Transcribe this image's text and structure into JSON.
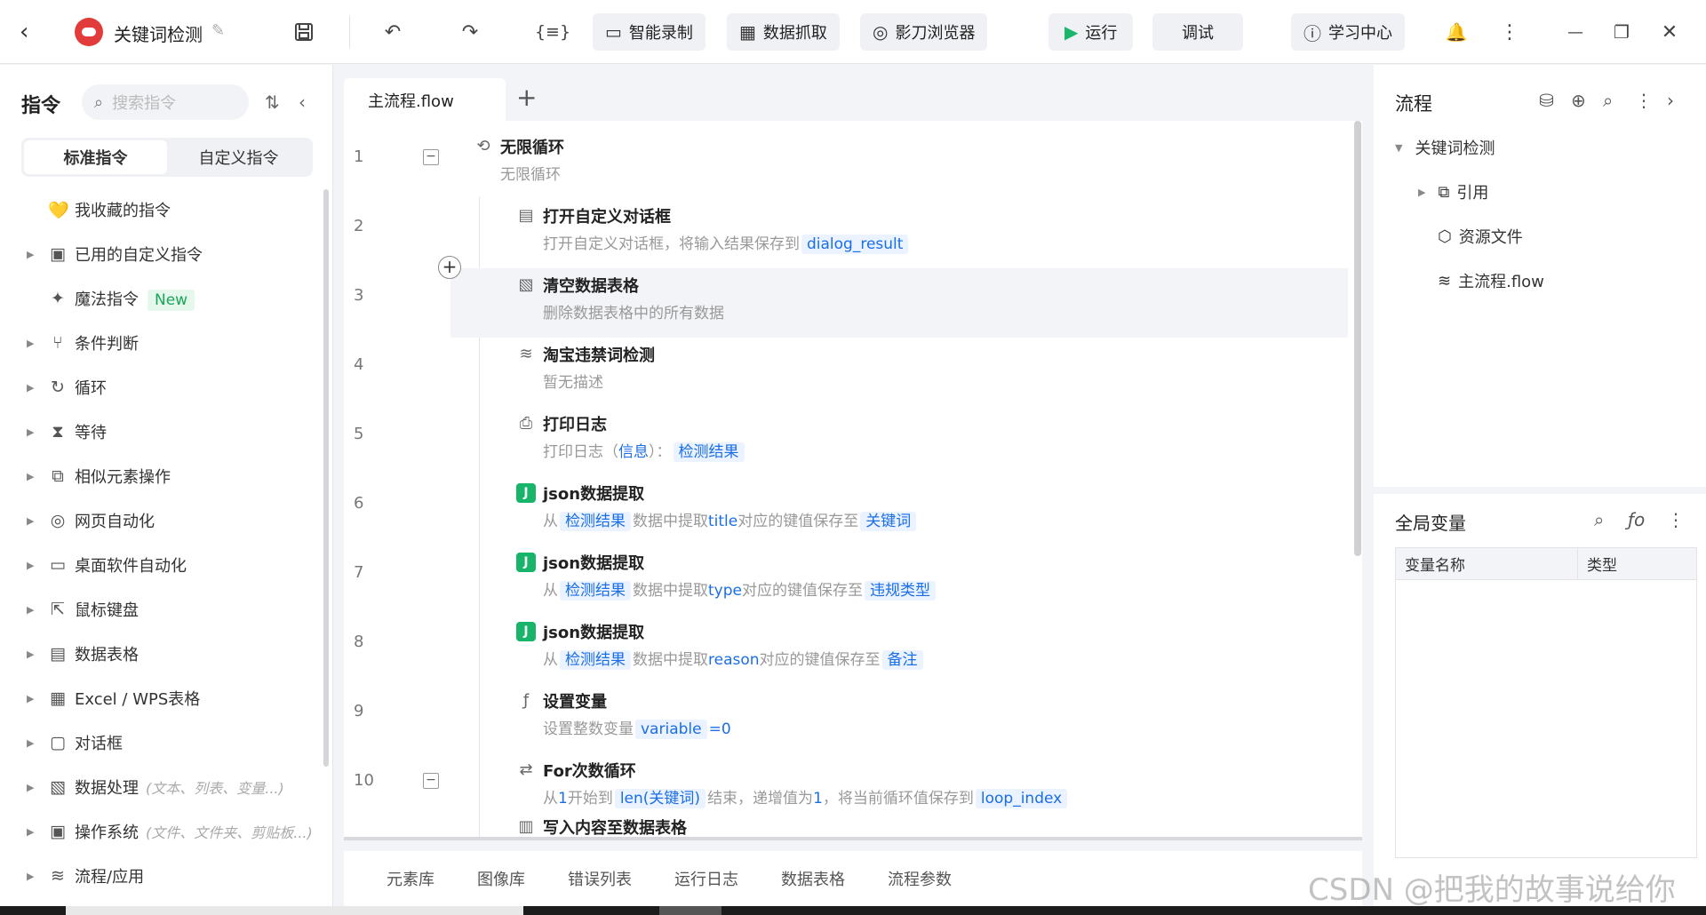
{
  "topbar": {
    "back": "‹",
    "title": "关键词检测",
    "buttons": {
      "smart_record": "智能录制",
      "data_capture": "数据抓取",
      "browser": "影刀浏览器",
      "run": "运行",
      "debug": "调试",
      "learn": "学习中心"
    },
    "icons": {
      "save": "💾",
      "undo": "↶",
      "redo": "↷",
      "code": "{≡}",
      "bell": "🔔",
      "more": "⋮",
      "min": "—",
      "max": "❐",
      "close": "✕"
    }
  },
  "sidebar": {
    "title": "指令",
    "search_placeholder": "搜索指令",
    "tabs": [
      "标准指令",
      "自定义指令"
    ],
    "items": [
      {
        "label": "我收藏的指令",
        "icon": "💛",
        "arrow": ""
      },
      {
        "label": "已用的自定义指令",
        "icon": "▣",
        "arrow": "▶"
      },
      {
        "label": "魔法指令",
        "icon": "✦",
        "arrow": "",
        "badge": "New"
      },
      {
        "label": "条件判断",
        "icon": "⑂",
        "arrow": "▶"
      },
      {
        "label": "循环",
        "icon": "↻",
        "arrow": "▶"
      },
      {
        "label": "等待",
        "icon": "⧗",
        "arrow": "▶"
      },
      {
        "label": "相似元素操作",
        "icon": "⧉",
        "arrow": "▶"
      },
      {
        "label": "网页自动化",
        "icon": "◎",
        "arrow": "▶"
      },
      {
        "label": "桌面软件自动化",
        "icon": "▭",
        "arrow": "▶"
      },
      {
        "label": "鼠标键盘",
        "icon": "⇱",
        "arrow": "▶"
      },
      {
        "label": "数据表格",
        "icon": "▤",
        "arrow": "▶"
      },
      {
        "label": "Excel / WPS表格",
        "icon": "▦",
        "arrow": "▶"
      },
      {
        "label": "对话框",
        "icon": "▢",
        "arrow": "▶"
      },
      {
        "label": "数据处理",
        "icon": "▧",
        "arrow": "▶",
        "hint": "(文本、列表、变量...)"
      },
      {
        "label": "操作系统",
        "icon": "▣",
        "arrow": "▶",
        "hint": "(文件、文件夹、剪贴板...)"
      },
      {
        "label": "流程/应用",
        "icon": "≋",
        "arrow": "▶"
      }
    ]
  },
  "editor": {
    "tab": "主流程.flow",
    "add": "+",
    "lines": [
      "1",
      "2",
      "3",
      "4",
      "5",
      "6",
      "7",
      "8",
      "9",
      "10"
    ],
    "rows": [
      {
        "title": "无限循环",
        "desc": "无限循环",
        "icon": "⟲"
      },
      {
        "title": "打开自定义对话框",
        "desc_pre": "打开自定义对话框，将输入结果保存到",
        "var1": "dialog_result",
        "icon": "▤"
      },
      {
        "title": "清空数据表格",
        "desc": "删除数据表格中的所有数据",
        "icon": "▧"
      },
      {
        "title": "淘宝违禁词检测",
        "desc": "暂无描述",
        "icon": "≋"
      },
      {
        "title": "打印日志",
        "desc_pre": "打印日志（",
        "kw": "信息",
        "desc_mid": "）：",
        "var1": "检测结果",
        "icon": "⎙"
      },
      {
        "title": "json数据提取",
        "desc_pre": "从",
        "var1": "检测结果",
        "desc_mid": "数据中提取",
        "kw": "title",
        "desc_post": "对应的键值保存至",
        "var2": "关键词",
        "icon": "J"
      },
      {
        "title": "json数据提取",
        "desc_pre": "从",
        "var1": "检测结果",
        "desc_mid": "数据中提取",
        "kw": "type",
        "desc_post": "对应的键值保存至",
        "var2": "违规类型",
        "icon": "J"
      },
      {
        "title": "json数据提取",
        "desc_pre": "从",
        "var1": "检测结果",
        "desc_mid": "数据中提取",
        "kw": "reason",
        "desc_post": "对应的键值保存至",
        "var2": "备注",
        "icon": "J"
      },
      {
        "title": "设置变量",
        "desc_pre": "设置整数变量",
        "var1": "variable",
        "desc_post": "=",
        "kw": "0",
        "icon": "ƒ"
      },
      {
        "title": "For次数循环",
        "desc_pre": "从",
        "kw": "1",
        "desc_mid": "开始到",
        "var1": "len(关键词)",
        "desc_post": "结束，递增值为",
        "kw2": "1",
        "desc_post2": "，将当前循环值保存到",
        "var2": "loop_index",
        "icon": "⇄"
      }
    ],
    "partial_row": "写入内容至数据表格"
  },
  "bottom_tabs": [
    "元素库",
    "图像库",
    "错误列表",
    "运行日志",
    "数据表格",
    "流程参数"
  ],
  "right_panel": {
    "title": "流程",
    "tree": {
      "root": "关键词检测",
      "children": [
        "引用",
        "资源文件",
        "主流程.flow"
      ]
    },
    "global_vars": {
      "title": "全局变量",
      "columns": [
        "变量名称",
        "类型"
      ]
    }
  },
  "watermark": "CSDN @把我的故事说给你"
}
